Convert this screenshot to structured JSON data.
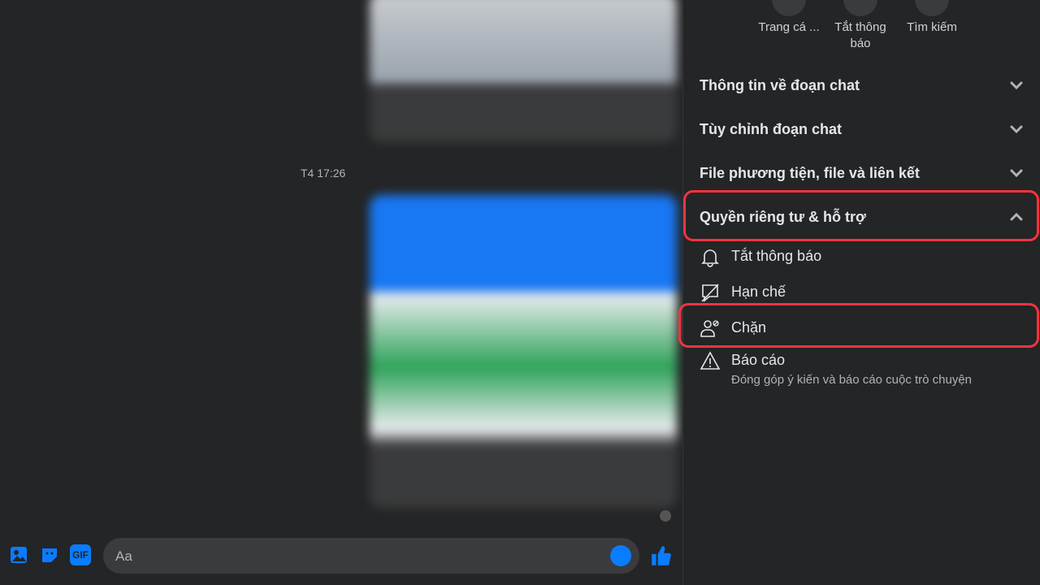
{
  "chat": {
    "timestamp": "T4 17:26",
    "composer_placeholder": "Aa",
    "composer_icons": [
      "image-icon",
      "sticker-icon",
      "gif-icon",
      "emoji-icon",
      "thumbs-up-icon"
    ],
    "gif_label": "GIF"
  },
  "panel": {
    "actions": [
      {
        "label": "Trang cá ..."
      },
      {
        "label": "Tắt thông báo"
      },
      {
        "label": "Tìm kiếm"
      }
    ],
    "sections": [
      {
        "label": "Thông tin về đoạn chat",
        "expanded": false
      },
      {
        "label": "Tùy chỉnh đoạn chat",
        "expanded": false
      },
      {
        "label": "File phương tiện, file và liên kết",
        "expanded": false
      },
      {
        "label": "Quyền riêng tư & hỗ trợ",
        "expanded": true
      }
    ],
    "privacy_items": [
      {
        "label": "Tắt thông báo",
        "icon": "bell-icon"
      },
      {
        "label": "Hạn chế",
        "icon": "restrict-icon"
      },
      {
        "label": "Chặn",
        "icon": "block-user-icon"
      },
      {
        "label": "Báo cáo",
        "sub": "Đóng góp ý kiến và báo cáo cuộc trò chuyện",
        "icon": "warning-icon"
      }
    ]
  },
  "colors": {
    "accent": "#0a7cff",
    "highlight": "#f5333f",
    "background": "#242526"
  }
}
